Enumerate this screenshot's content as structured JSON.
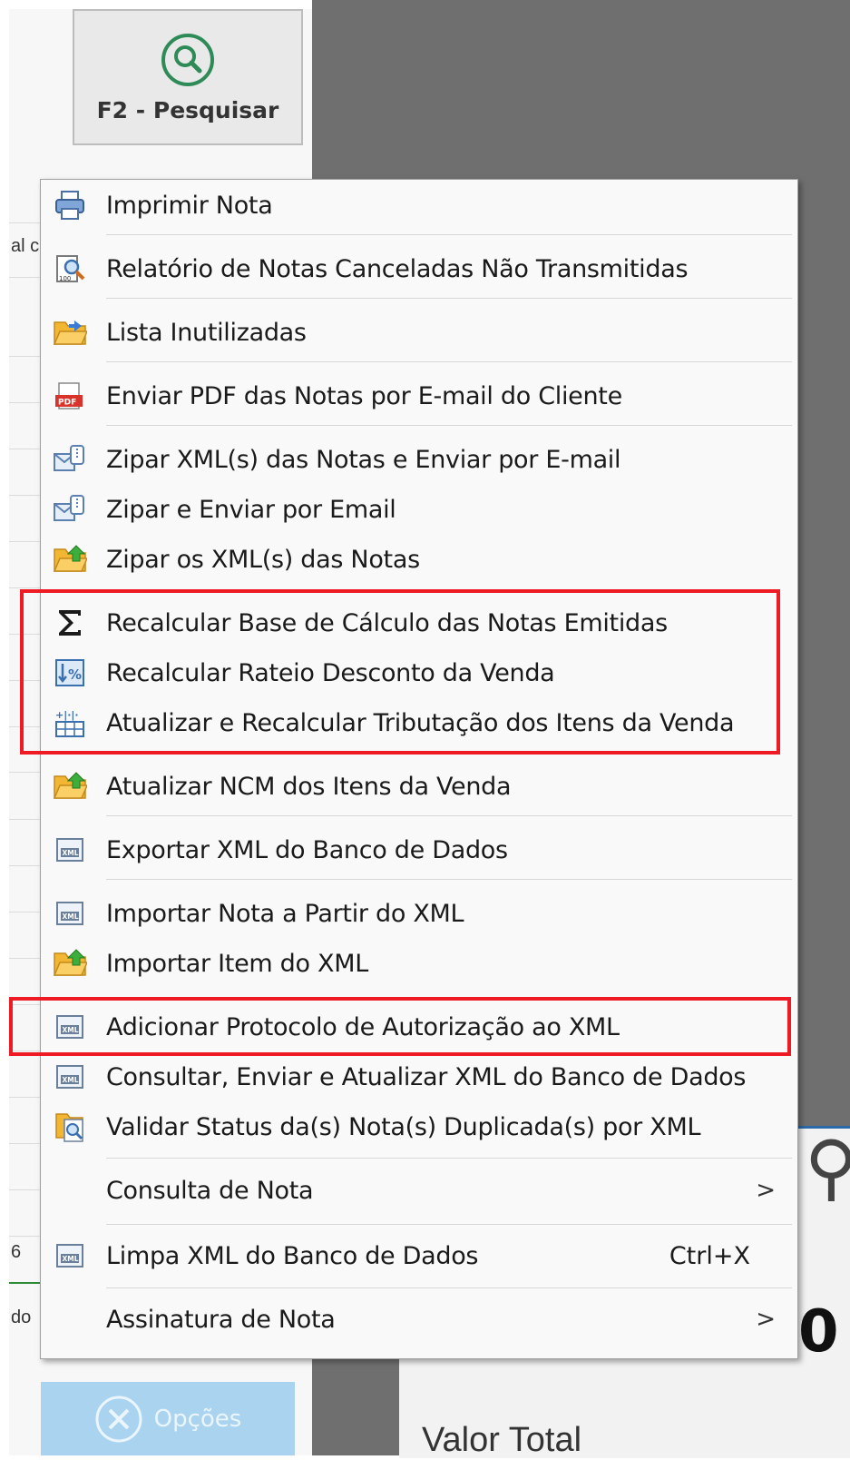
{
  "toolbar": {
    "search_label": "F2 - Pesquisar",
    "options_label": "Opções"
  },
  "background": {
    "grid_fragments": [
      "al c",
      "6",
      "do"
    ],
    "total_label": "Valor Total",
    "partial_text": "0"
  },
  "context_menu": {
    "items": [
      {
        "label": "Imprimir Nota",
        "icon": "printer-icon"
      },
      {
        "label": "Relatório de Notas Canceladas Não Transmitidas",
        "icon": "report-search-icon"
      },
      {
        "label": "Lista Inutilizadas",
        "icon": "folder-open-icon"
      },
      {
        "label": "Enviar PDF das Notas por E-mail do Cliente",
        "icon": "pdf-icon"
      },
      {
        "label": "Zipar XML(s) das Notas e Enviar por E-mail",
        "icon": "zip-email-icon"
      },
      {
        "label": "Zipar e Enviar por Email",
        "icon": "zip-email-icon"
      },
      {
        "label": "Zipar os XML(s) das Notas",
        "icon": "folder-upload-icon"
      },
      {
        "label": "Recalcular Base de Cálculo das Notas Emitidas",
        "icon": "sigma-icon"
      },
      {
        "label": "Recalcular Rateio Desconto da Venda",
        "icon": "percent-icon"
      },
      {
        "label": "Atualizar e Recalcular Tributação dos Itens da Venda",
        "icon": "calculator-icon"
      },
      {
        "label": "Atualizar NCM dos Itens da Venda",
        "icon": "folder-upload-icon"
      },
      {
        "label": "Exportar XML do Banco de Dados",
        "icon": "xml-file-icon"
      },
      {
        "label": "Importar Nota a Partir do XML",
        "icon": "xml-file-icon"
      },
      {
        "label": "Importar Item do XML",
        "icon": "folder-upload-icon"
      },
      {
        "label": "Adicionar Protocolo de Autorização ao XML",
        "icon": "xml-file-icon"
      },
      {
        "label": "Consultar, Enviar e Atualizar XML do Banco de Dados",
        "icon": "xml-file-icon"
      },
      {
        "label": "Validar Status da(s) Nota(s) Duplicada(s) por XML",
        "icon": "document-search-icon"
      },
      {
        "label": "Consulta de Nota",
        "icon": "none",
        "submenu": true
      },
      {
        "label": "Limpa XML do Banco de Dados",
        "icon": "xml-file-icon",
        "shortcut": "Ctrl+X"
      },
      {
        "label": "Assinatura de Nota",
        "icon": "none",
        "submenu": true
      }
    ],
    "submenu_arrow": ">",
    "highlight_color": "#ee1b24"
  }
}
